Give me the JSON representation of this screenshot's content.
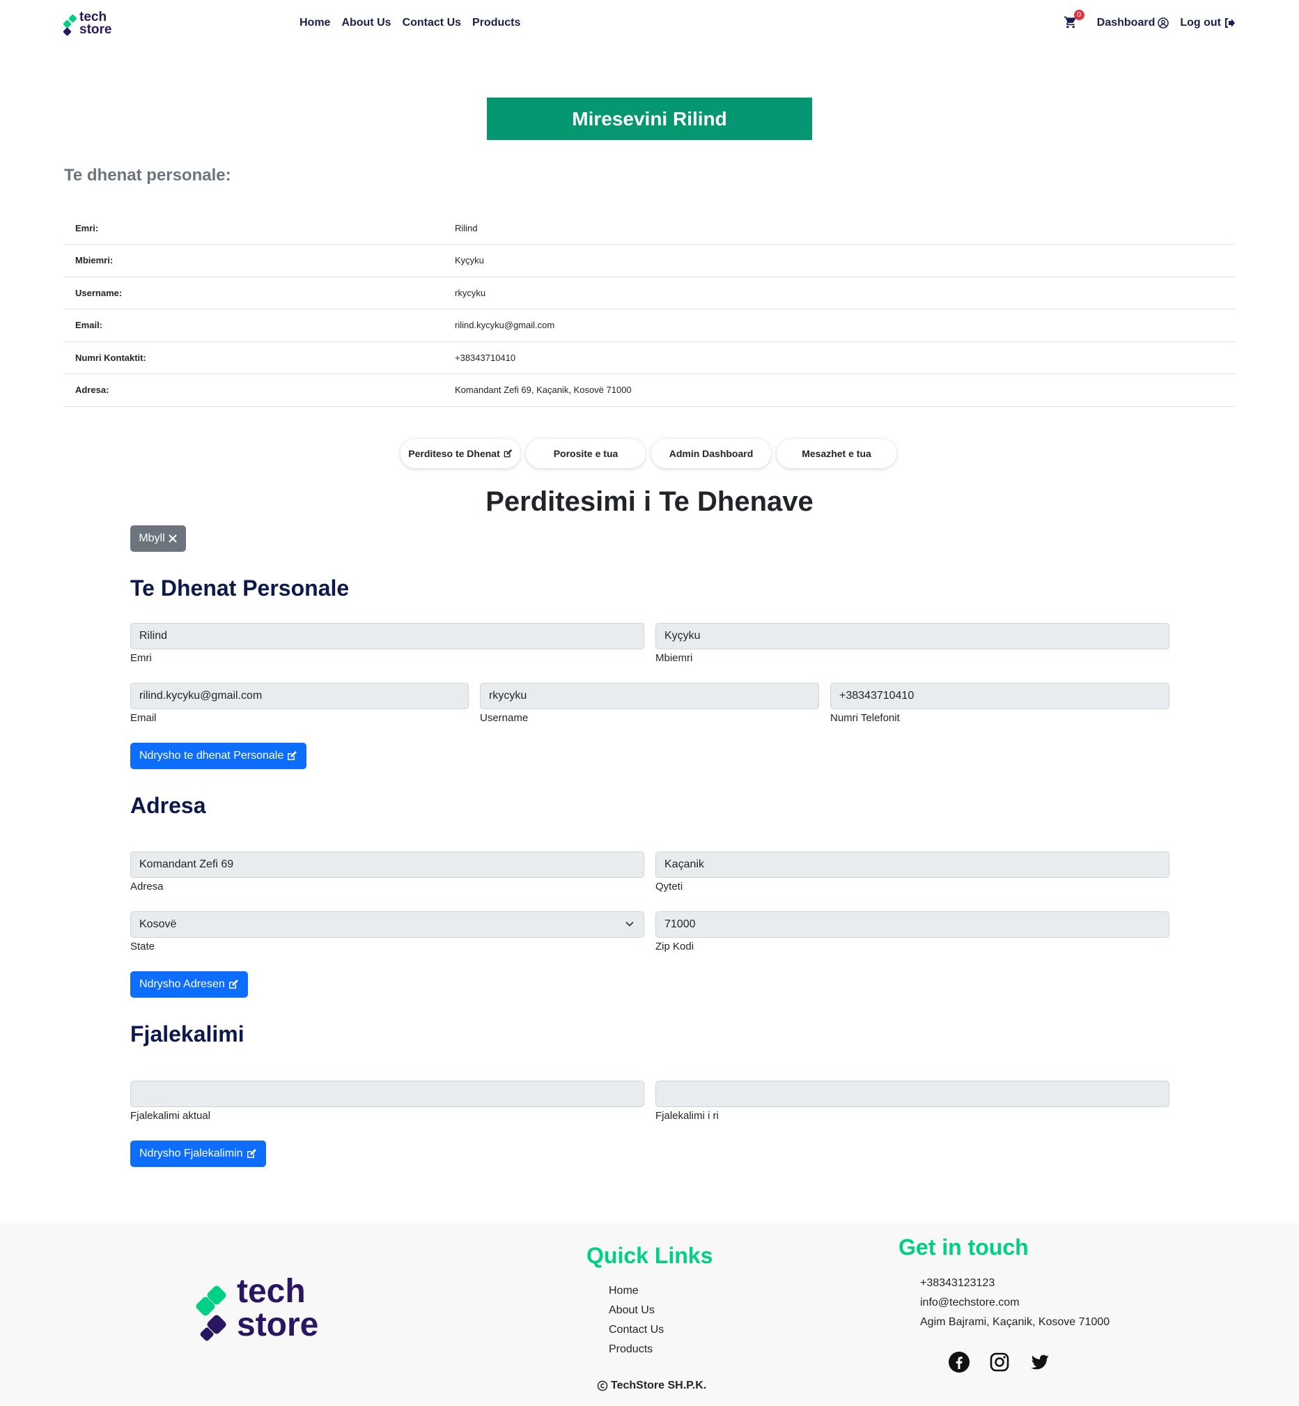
{
  "nav": {
    "brand_line1": "tech",
    "brand_line2": "store",
    "links": [
      "Home",
      "About Us",
      "Contact Us",
      "Products"
    ],
    "cart_count": "0",
    "dashboard": "Dashboard",
    "logout": "Log out"
  },
  "welcome": "Miresevini Rilind",
  "personal_heading": "Te dhenat personale:",
  "info_rows": [
    {
      "key": "Emri:",
      "value": "Rilind"
    },
    {
      "key": "Mbiemri:",
      "value": "Kyçyku"
    },
    {
      "key": "Username:",
      "value": "rkycyku"
    },
    {
      "key": "Email:",
      "value": "rilind.kycyku@gmail.com"
    },
    {
      "key": "Numri Kontaktit:",
      "value": "+38343710410"
    },
    {
      "key": "Adresa:",
      "value": "Komandant Zefi 69, Kaçanik, Kosovë 71000"
    }
  ],
  "pills": [
    "Perditeso te Dhenat",
    "Porosite e tua",
    "Admin Dashboard",
    "Mesazhet e tua"
  ],
  "update_title": "Perditesimi i Te Dhenave",
  "close_label": "Mbyll",
  "personal_section": {
    "title": "Te Dhenat Personale",
    "emri_value": "Rilind",
    "emri_label": "Emri",
    "mbiemri_value": "Kyçyku",
    "mbiemri_label": "Mbiemri",
    "email_value": "rilind.kycyku@gmail.com",
    "email_label": "Email",
    "username_value": "rkycyku",
    "username_label": "Username",
    "phone_value": "+38343710410",
    "phone_label": "Numri Telefonit",
    "button": "Ndrysho te dhenat Personale"
  },
  "address_section": {
    "title": "Adresa",
    "adresa_value": "Komandant Zefi 69",
    "adresa_label": "Adresa",
    "qyteti_value": "Kaçanik",
    "qyteti_label": "Qyteti",
    "state_value": "Kosovë",
    "state_label": "State",
    "zip_value": "71000",
    "zip_label": "Zip Kodi",
    "button": "Ndrysho Adresen"
  },
  "password_section": {
    "title": "Fjalekalimi",
    "current_label": "Fjalekalimi aktual",
    "new_label": "Fjalekalimi i ri",
    "button": "Ndrysho Fjalekalimin"
  },
  "footer": {
    "quick_links_title": "Quick Links",
    "links": [
      "Home",
      "About Us",
      "Contact Us",
      "Products"
    ],
    "contact_title": "Get in touch",
    "phone": "+38343123123",
    "email": "info@techstore.com",
    "address": "Agim Bajrami, Kaçanik, Kosove 71000",
    "copyright": "TechStore SH.P.K."
  },
  "colors": {
    "brand_green": "#00d084",
    "brand_purple": "#2a1660",
    "welcome_bg": "#059672",
    "primary_blue": "#0d6efd"
  },
  "icons": [
    "cart-icon",
    "user-circle-icon",
    "logout-icon",
    "edit-icon",
    "close-icon",
    "chevron-down-icon",
    "copyright-icon",
    "facebook-icon",
    "instagram-icon",
    "twitter-icon"
  ]
}
